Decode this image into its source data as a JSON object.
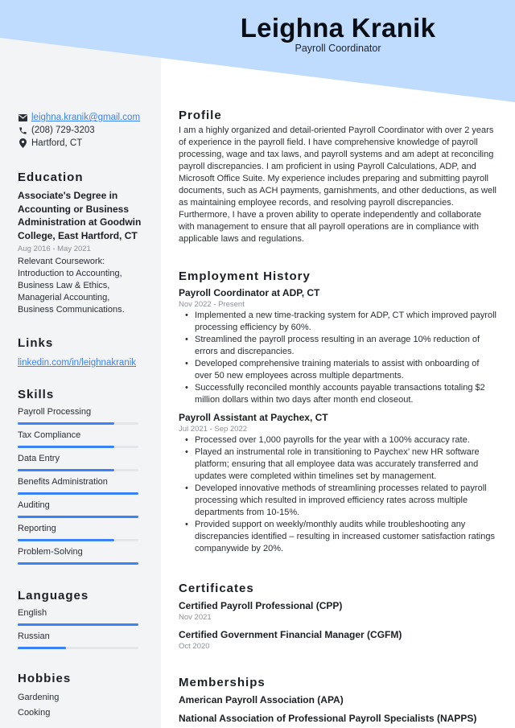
{
  "header": {
    "name": "Leighna Kranik",
    "title": "Payroll Coordinator",
    "band_color": "#bfdbfe"
  },
  "contact": {
    "email": "leighna.kranik@gmail.com",
    "phone": "(208) 729-3203",
    "location": "Hartford, CT",
    "icons": [
      "envelope-icon",
      "phone-icon",
      "map-pin-icon"
    ]
  },
  "education": {
    "heading": "Education",
    "degree": "Associate's Degree in Accounting or Business Administration at Goodwin College, East Hartford, CT",
    "dates": "Aug 2016 - May 2021",
    "description": "Relevant Coursework: Introduction to Accounting, Business Law & Ethics, Managerial Accounting, Business Communications."
  },
  "links": {
    "heading": "Links",
    "items": [
      "linkedin.com/in/leighnakranik"
    ]
  },
  "skills": {
    "heading": "Skills",
    "items": [
      {
        "name": "Payroll Processing",
        "level": 0.8
      },
      {
        "name": "Tax Compliance",
        "level": 0.8
      },
      {
        "name": "Data Entry",
        "level": 0.8
      },
      {
        "name": "Benefits Administration",
        "level": 1.0
      },
      {
        "name": "Auditing",
        "level": 1.0
      },
      {
        "name": "Reporting",
        "level": 0.8
      },
      {
        "name": "Problem-Solving",
        "level": 1.0
      }
    ]
  },
  "languages": {
    "heading": "Languages",
    "items": [
      {
        "name": "English",
        "level": 1.0
      },
      {
        "name": "Russian",
        "level": 0.4
      }
    ]
  },
  "hobbies": {
    "heading": "Hobbies",
    "items": [
      "Gardening",
      "Cooking"
    ]
  },
  "profile": {
    "heading": "Profile",
    "text": "I am a highly organized and detail-oriented Payroll Coordinator with over 2 years of experience in the payroll field. I have comprehensive knowledge of payroll processing, wage and tax laws, and payroll systems and am adept at reconciling payroll discrepancies. I am proficient in using Payroll Calculations, ADP, and Microsoft Office Suite. My experience includes preparing and submitting payroll documents, such as ACH payments, garnishments, and other deductions, as well as maintaining employee records, and resolving payroll discrepancies. Furthermore, I have a proven ability to operate independently and collaborate with management to ensure that all payroll operations are in compliance with applicable laws and regulations."
  },
  "employment": {
    "heading": "Employment History",
    "jobs": [
      {
        "title": "Payroll Coordinator at ADP, CT",
        "dates": "Nov 2022 - Present",
        "bullets": [
          "Implemented a new time-tracking system for ADP, CT which improved payroll processing efficiency by 60%.",
          "Streamlined the payroll process resulting in an average 10% reduction of errors and discrepancies.",
          "Developed comprehensive training materials to assist with onboarding of over 50 new employees across multiple departments.",
          "Successfully reconciled monthly accounts payable transactions totaling $2 million dollars within two days after month end closeout."
        ]
      },
      {
        "title": "Payroll Assistant at Paychex, CT",
        "dates": "Jul 2021 - Sep 2022",
        "bullets": [
          "Processed over 1,000 payrolls for the year with a 100% accuracy rate.",
          "Played an instrumental role in transitioning to Paychex’ new HR software platform; ensuring that all employee data was accurately transferred and updates were completed within timelines set by management.",
          "Developed innovative methods of streamlining processes related to payroll processing which resulted in improved efficiency rates across multiple departments from 10-15%.",
          "Provided support on weekly/monthly audits while troubleshooting any discrepancies identified – resulting in increased customer satisfaction ratings companywide by 20%."
        ]
      }
    ]
  },
  "certificates": {
    "heading": "Certificates",
    "items": [
      {
        "name": "Certified Payroll Professional (CPP)",
        "date": "Nov 2021"
      },
      {
        "name": "Certified Government Financial Manager (CGFM)",
        "date": "Oct 2020"
      }
    ]
  },
  "memberships": {
    "heading": "Memberships",
    "items": [
      "American Payroll Association (APA)",
      "National Association of Professional Payroll Specialists (NAPPS)"
    ]
  }
}
